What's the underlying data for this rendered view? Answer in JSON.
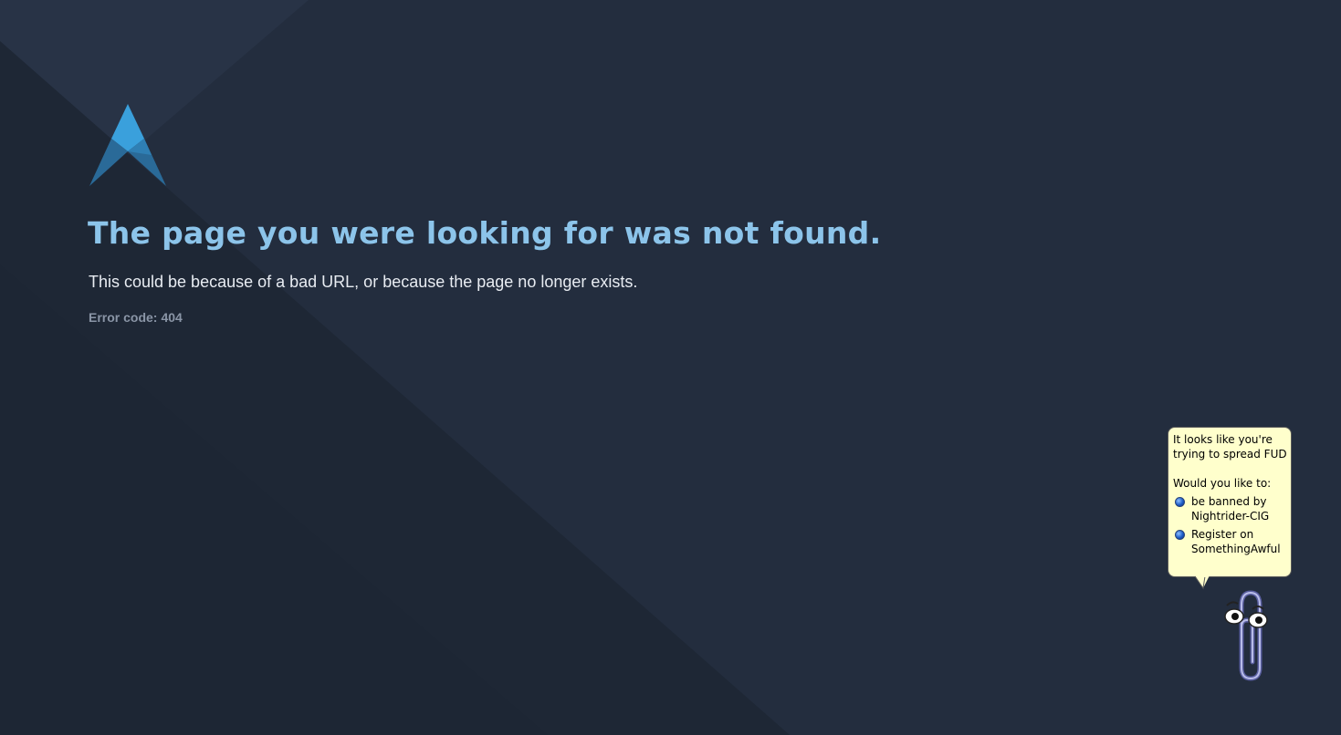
{
  "page": {
    "title": "The page you were looking for was not found.",
    "subtitle": "This could be because of a bad URL, or because the page no longer exists.",
    "error_label": "Error code:",
    "error_code": "404"
  },
  "logo": {
    "icon": "triangle-logo-icon"
  },
  "clippy": {
    "icon": "paperclip-assistant-icon",
    "line1": "It looks like you're trying to spread FUD",
    "prompt": "Would you like to:",
    "options": [
      {
        "label": "be banned by Nightrider-CIG"
      },
      {
        "label": "Register on SomethingAwful"
      }
    ]
  },
  "colors": {
    "background": "#232d3e",
    "title": "#8cc4ea",
    "subtitle": "#e8ecf2",
    "error_code": "#8a95a6",
    "bubble": "#ffffcc"
  }
}
